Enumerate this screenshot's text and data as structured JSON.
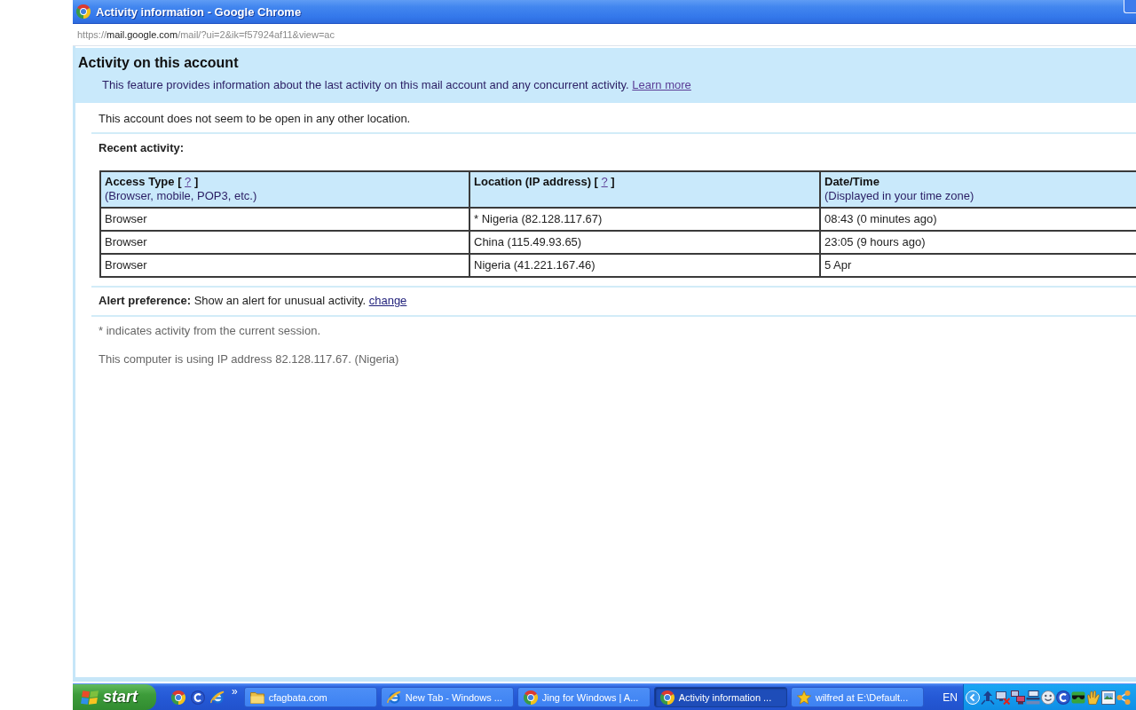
{
  "window": {
    "title": "Activity information - Google Chrome"
  },
  "address_bar": {
    "url": [
      {
        "text": "https://",
        "kind": "dim"
      },
      {
        "text": "mail.google.com",
        "kind": "host"
      },
      {
        "text": "/mail/?ui=2&ik=f57924af11&view=ac",
        "kind": "dim"
      }
    ]
  },
  "page": {
    "heading": "Activity on this account",
    "intro": [
      {
        "text": "This feature provides information about the last activity on this mail account and any concurrent activity. ",
        "kind": "text"
      },
      {
        "text": "Learn more",
        "kind": "link"
      }
    ],
    "session_status": "This account does not seem to be open in any other location.",
    "recent_activity_label": "Recent activity:",
    "table": {
      "columns": [
        {
          "title": [
            {
              "text": "Access Type [ ",
              "kind": "text"
            },
            {
              "text": "?",
              "kind": "link"
            },
            {
              "text": " ]",
              "kind": "text"
            }
          ],
          "note": "(Browser, mobile, POP3, etc.)"
        },
        {
          "title": [
            {
              "text": "Location (IP address) [ ",
              "kind": "text"
            },
            {
              "text": "?",
              "kind": "link"
            },
            {
              "text": " ]",
              "kind": "text"
            }
          ]
        },
        {
          "title": [
            {
              "text": "Date/Time",
              "kind": "text"
            }
          ],
          "note": "(Displayed in your time zone)"
        }
      ],
      "rows": [
        [
          "Browser",
          "* Nigeria (82.128.117.67)",
          "08:43 (0 minutes ago)"
        ],
        [
          "Browser",
          "China (115.49.93.65)",
          "23:05 (9 hours ago)"
        ],
        [
          "Browser",
          "Nigeria (41.221.167.46)",
          "5 Apr"
        ]
      ]
    },
    "alert_preference": [
      {
        "text": "Alert preference:",
        "kind": "bold"
      },
      {
        "text": " Show an alert for unusual activity. ",
        "kind": "text"
      },
      {
        "text": "change",
        "kind": "link"
      }
    ],
    "footnote": "* indicates activity from the current session.",
    "ip_note": "This computer is using IP address 82.128.117.67. (Nigeria)"
  },
  "taskbar": {
    "start_label": "start",
    "more_button": "»",
    "tasks": [
      {
        "label": "cfagbata.com",
        "kind": "folder",
        "selected": false
      },
      {
        "label": "New Tab - Windows ...",
        "kind": "explorer",
        "selected": false
      },
      {
        "label": "Jing for Windows | A...",
        "kind": "chrome",
        "selected": false
      },
      {
        "label": "Activity information ...",
        "kind": "chrome",
        "selected": true
      },
      {
        "label": "wilfred at E:\\Default...",
        "kind": "star",
        "selected": false
      }
    ],
    "language": "EN"
  }
}
